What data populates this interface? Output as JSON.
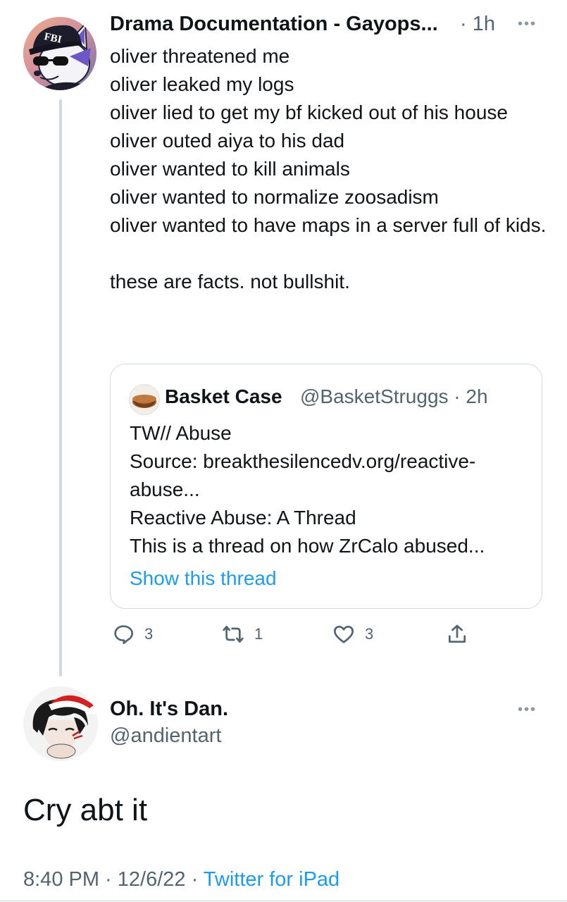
{
  "tweet1": {
    "display_name": "Drama Documentation - Gayops...",
    "time": "· 1h",
    "hat_text": "FBI",
    "more_icon": "more-dots-icon",
    "body": "oliver threatened me\noliver leaked my logs\noliver lied to get my bf kicked out of his house\noliver outed aiya to his dad\noliver wanted to kill animals\noliver wanted to normalize zoosadism\noliver wanted to have maps in a server full of kids.\n\nthese are facts. not bullshit.",
    "quote": {
      "name": "Basket Case",
      "handle": "@BasketStruggs · 2h",
      "body": "TW// Abuse\nSource: breakthesilencedv.org/reactive-abuse...\nReactive Abuse: A Thread\nThis is a thread on how ZrCalo abused...",
      "link": "Show this thread"
    },
    "actions": {
      "replies": "3",
      "retweets": "1",
      "likes": "3"
    }
  },
  "tweet2": {
    "display_name": "Oh. It's Dan.",
    "handle": "@andientart",
    "body": "Cry abt it",
    "meta_time": "8:40 PM · 12/6/22 · ",
    "meta_source": "Twitter for iPad"
  },
  "colors": {
    "text": "#0f1419",
    "secondary": "#536471",
    "link": "#1d9bf0",
    "border": "#cfd9de"
  }
}
